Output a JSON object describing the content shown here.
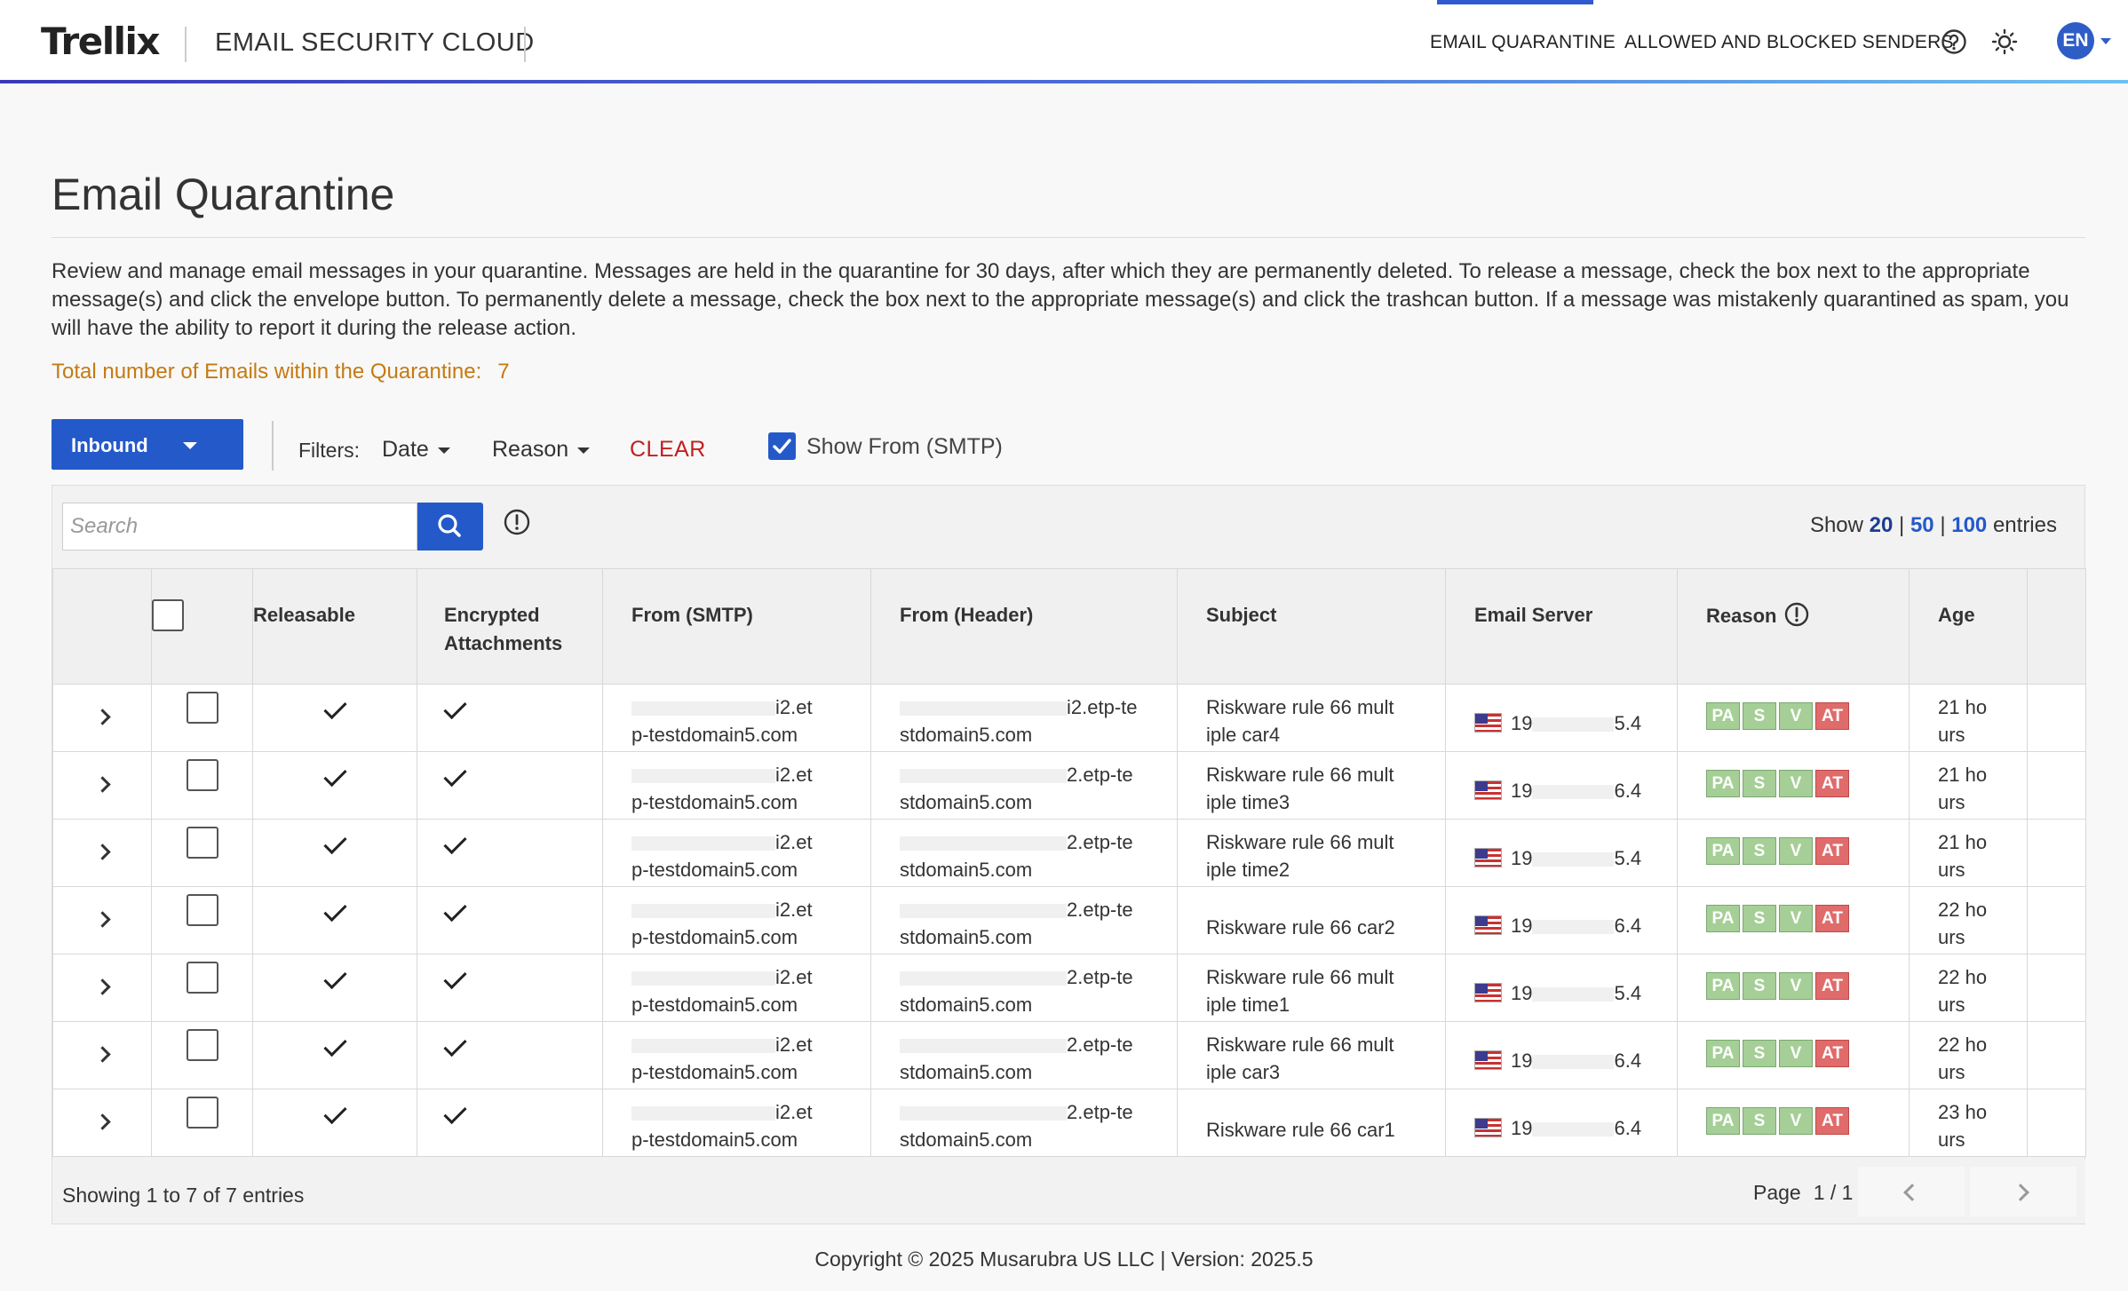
{
  "header": {
    "logo": "Trellix",
    "product": "EMAIL SECURITY CLOUD",
    "nav": [
      {
        "label": "EMAIL QUARANTINE",
        "active": true
      },
      {
        "label": "ALLOWED AND BLOCKED SENDERS",
        "active": false
      }
    ],
    "icons": [
      "help-circle-icon",
      "sun-icon"
    ],
    "avatar": "EN",
    "accent": "#2f5bce"
  },
  "page": {
    "title": "Email Quarantine",
    "description": "Review and manage email messages in your quarantine. Messages are held in the quarantine for 30 days, after which they are permanently deleted. To release a message, check the box next to the appropriate message(s) and click the envelope button. To permanently delete a message, check the box next to the appropriate message(s) and click the trashcan button. If a message was mistakenly quarantined as spam, you will have the ability to report it during the release action.",
    "total_label": "Total number of Emails within the Quarantine:",
    "total_count": "7"
  },
  "toolbar": {
    "direction": "Inbound",
    "filters_label": "Filters:",
    "filter_date": "Date",
    "filter_reason": "Reason",
    "clear": "CLEAR",
    "show_smtp_label": "Show From (SMTP)",
    "show_smtp_checked": true
  },
  "search": {
    "placeholder": "Search",
    "show_label": "Show",
    "sizes": [
      "20",
      "50",
      "100"
    ],
    "selected_size": "20",
    "entries_label": "entries"
  },
  "table": {
    "columns": [
      "Releasable",
      "Encrypted Attachments",
      "From (SMTP)",
      "From (Header)",
      "Subject",
      "Email Server",
      "Reason",
      "Age"
    ],
    "rows": [
      {
        "smtp_top": "i2.et",
        "smtp_bottom": "p-testdomain5.com",
        "header_top": "i2.etp-te",
        "header_bottom": "stdomain5.com",
        "subject": [
          "Riskware rule 66 mult",
          "iple car4"
        ],
        "server_prefix": "19",
        "server_suffix": "5.4",
        "reasons": [
          "PA",
          "S",
          "V",
          "AT"
        ],
        "age": [
          "21 ho",
          "urs"
        ]
      },
      {
        "smtp_top": "i2.et",
        "smtp_bottom": "p-testdomain5.com",
        "header_top": "2.etp-te",
        "header_bottom": "stdomain5.com",
        "subject": [
          "Riskware rule 66 mult",
          "iple time3"
        ],
        "server_prefix": "19",
        "server_suffix": "6.4",
        "reasons": [
          "PA",
          "S",
          "V",
          "AT"
        ],
        "age": [
          "21 ho",
          "urs"
        ]
      },
      {
        "smtp_top": "i2.et",
        "smtp_bottom": "p-testdomain5.com",
        "header_top": "2.etp-te",
        "header_bottom": "stdomain5.com",
        "subject": [
          "Riskware rule 66 mult",
          "iple time2"
        ],
        "server_prefix": "19",
        "server_suffix": "5.4",
        "reasons": [
          "PA",
          "S",
          "V",
          "AT"
        ],
        "age": [
          "21 ho",
          "urs"
        ]
      },
      {
        "smtp_top": "i2.et",
        "smtp_bottom": "p-testdomain5.com",
        "header_top": "2.etp-te",
        "header_bottom": "stdomain5.com",
        "subject": [
          "Riskware rule 66 car2"
        ],
        "server_prefix": "19",
        "server_suffix": "6.4",
        "reasons": [
          "PA",
          "S",
          "V",
          "AT"
        ],
        "age": [
          "22 ho",
          "urs"
        ]
      },
      {
        "smtp_top": "i2.et",
        "smtp_bottom": "p-testdomain5.com",
        "header_top": "2.etp-te",
        "header_bottom": "stdomain5.com",
        "subject": [
          "Riskware rule 66 mult",
          "iple time1"
        ],
        "server_prefix": "19",
        "server_suffix": "5.4",
        "reasons": [
          "PA",
          "S",
          "V",
          "AT"
        ],
        "age": [
          "22 ho",
          "urs"
        ]
      },
      {
        "smtp_top": "i2.et",
        "smtp_bottom": "p-testdomain5.com",
        "header_top": "2.etp-te",
        "header_bottom": "stdomain5.com",
        "subject": [
          "Riskware rule 66 mult",
          "iple car3"
        ],
        "server_prefix": "19",
        "server_suffix": "6.4",
        "reasons": [
          "PA",
          "S",
          "V",
          "AT"
        ],
        "age": [
          "22 ho",
          "urs"
        ]
      },
      {
        "smtp_top": "i2.et",
        "smtp_bottom": "p-testdomain5.com",
        "header_top": "2.etp-te",
        "header_bottom": "stdomain5.com",
        "subject": [
          "Riskware rule 66 car1"
        ],
        "server_prefix": "19",
        "server_suffix": "6.4",
        "reasons": [
          "PA",
          "S",
          "V",
          "AT"
        ],
        "age": [
          "23 ho",
          "urs"
        ]
      }
    ]
  },
  "pagination": {
    "showing": "Showing 1 to 7 of 7 entries",
    "page_label": "Page",
    "current": "1",
    "total": "/ 1"
  },
  "footer": {
    "copyright": "Copyright © 2025 Musarubra US LLC | Version: 2025.5"
  }
}
